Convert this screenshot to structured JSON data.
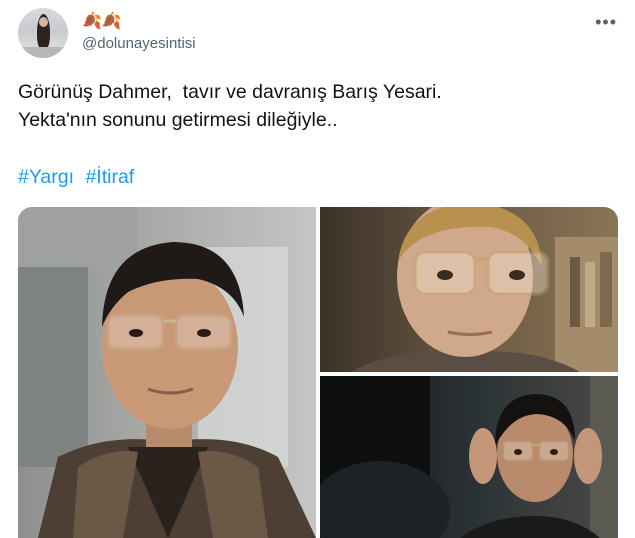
{
  "tweet": {
    "display_name_emoji": "🍂🍂",
    "handle": "@dolunayesintisi",
    "more_label": "•••",
    "text_lines": [
      "Görünüş Dahmer,  tavır ve davranış Barış Yesari.",
      "Yekta'nın sonunu getirmesi dileğiyle.."
    ],
    "hashtags": [
      "#Yargı",
      "#İtiraf"
    ]
  },
  "icons": {
    "more": "more-options-icon"
  }
}
